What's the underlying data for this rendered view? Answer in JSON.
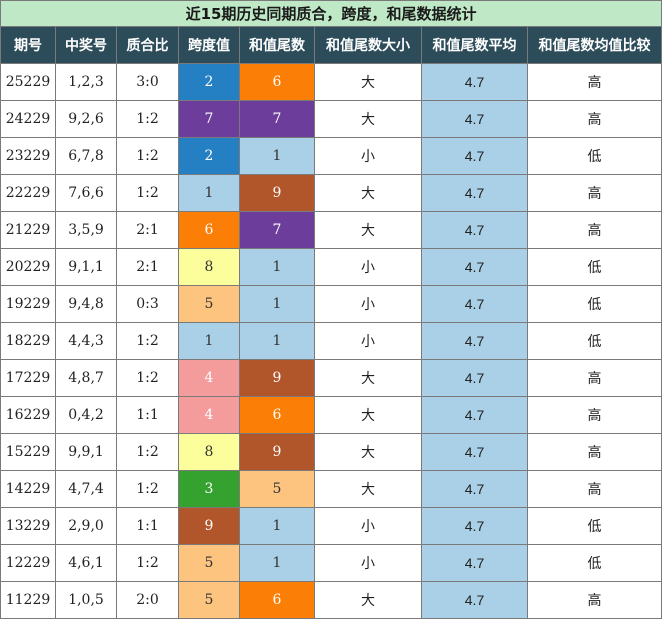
{
  "title": "近15期历史同期质合，跨度，和尾数据统计",
  "headers": [
    "期号",
    "中奖号",
    "质合比",
    "跨度值",
    "和值尾数",
    "和值尾数大小",
    "和值尾数平均",
    "和值尾数均值比较"
  ],
  "rows": [
    {
      "period": "25229",
      "numbers": "1,2,3",
      "ratio": "3:0",
      "span": "2",
      "tail": "6",
      "size": "大",
      "avg": "4.7",
      "cmp": "高"
    },
    {
      "period": "24229",
      "numbers": "9,2,6",
      "ratio": "1:2",
      "span": "7",
      "tail": "7",
      "size": "大",
      "avg": "4.7",
      "cmp": "高"
    },
    {
      "period": "23229",
      "numbers": "6,7,8",
      "ratio": "1:2",
      "span": "2",
      "tail": "1",
      "size": "小",
      "avg": "4.7",
      "cmp": "低"
    },
    {
      "period": "22229",
      "numbers": "7,6,6",
      "ratio": "1:2",
      "span": "1",
      "tail": "9",
      "size": "大",
      "avg": "4.7",
      "cmp": "高"
    },
    {
      "period": "21229",
      "numbers": "3,5,9",
      "ratio": "2:1",
      "span": "6",
      "tail": "7",
      "size": "大",
      "avg": "4.7",
      "cmp": "高"
    },
    {
      "period": "20229",
      "numbers": "9,1,1",
      "ratio": "2:1",
      "span": "8",
      "tail": "1",
      "size": "小",
      "avg": "4.7",
      "cmp": "低"
    },
    {
      "period": "19229",
      "numbers": "9,4,8",
      "ratio": "0:3",
      "span": "5",
      "tail": "1",
      "size": "小",
      "avg": "4.7",
      "cmp": "低"
    },
    {
      "period": "18229",
      "numbers": "4,4,3",
      "ratio": "1:2",
      "span": "1",
      "tail": "1",
      "size": "小",
      "avg": "4.7",
      "cmp": "低"
    },
    {
      "period": "17229",
      "numbers": "4,8,7",
      "ratio": "1:2",
      "span": "4",
      "tail": "9",
      "size": "大",
      "avg": "4.7",
      "cmp": "高"
    },
    {
      "period": "16229",
      "numbers": "0,4,2",
      "ratio": "1:1",
      "span": "4",
      "tail": "6",
      "size": "大",
      "avg": "4.7",
      "cmp": "高"
    },
    {
      "period": "15229",
      "numbers": "9,9,1",
      "ratio": "1:2",
      "span": "8",
      "tail": "9",
      "size": "大",
      "avg": "4.7",
      "cmp": "高"
    },
    {
      "period": "14229",
      "numbers": "4,7,4",
      "ratio": "1:2",
      "span": "3",
      "tail": "5",
      "size": "大",
      "avg": "4.7",
      "cmp": "高"
    },
    {
      "period": "13229",
      "numbers": "2,9,0",
      "ratio": "1:1",
      "span": "9",
      "tail": "1",
      "size": "小",
      "avg": "4.7",
      "cmp": "低"
    },
    {
      "period": "12229",
      "numbers": "4,6,1",
      "ratio": "1:2",
      "span": "5",
      "tail": "1",
      "size": "小",
      "avg": "4.7",
      "cmp": "低"
    },
    {
      "period": "11229",
      "numbers": "1,0,5",
      "ratio": "2:0",
      "span": "5",
      "tail": "6",
      "size": "大",
      "avg": "4.7",
      "cmp": "高"
    }
  ],
  "digit_colors": {
    "1": "#a9d0e6",
    "2": "#2580c3",
    "3": "#35a12e",
    "4": "#f49b9b",
    "5": "#fdc47f",
    "6": "#fb7f07",
    "7": "#6c3d9b",
    "8": "#fcfe9b",
    "9": "#b0562a"
  },
  "avg_color": "#a9d0e6",
  "title_bg": "#bfe9c6",
  "header_bg": "#2c4c5a"
}
